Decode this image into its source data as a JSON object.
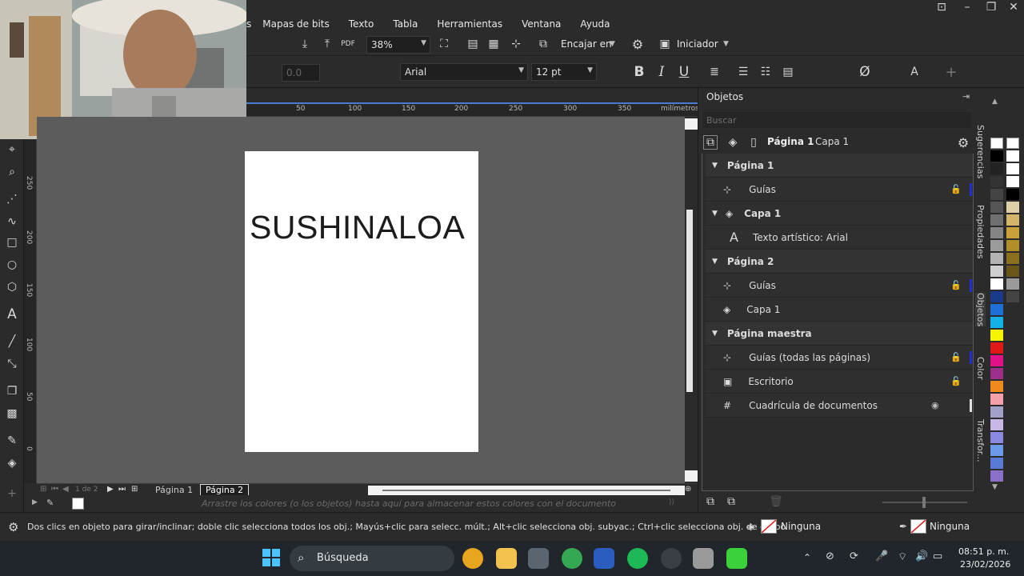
{
  "menu": [
    "s",
    "Mapas de bits",
    "Texto",
    "Tabla",
    "Herramientas",
    "Ventana",
    "Ayuda"
  ],
  "toolbar": {
    "zoom": "38%",
    "snap_label": "Encajar en",
    "launcher_label": "Iniciador",
    "pdf_label": "PDF"
  },
  "propbar": {
    "value_field": "0.0",
    "font_name": "Arial",
    "font_size": "12 pt",
    "bold": "B",
    "italic": "I",
    "underline": "U"
  },
  "ruler": {
    "h_ticks": [
      "50",
      "100",
      "150",
      "200",
      "250",
      "300",
      "350",
      "milímetros"
    ],
    "v_ticks": [
      "250",
      "200",
      "150",
      "100",
      "50",
      "0"
    ]
  },
  "document": {
    "text": "SUSHINALOA"
  },
  "page_nav": {
    "counter": "1 de 2",
    "tabs": [
      "Página 1",
      "Página 2"
    ]
  },
  "palette_hint": "Arrastre los colores (o los objetos) hasta aquí para almacenar estos colores con el documento",
  "objects_panel": {
    "title": "Objetos",
    "search_placeholder": "Buscar",
    "current_page": "Página 1",
    "current_layer": "Capa 1",
    "tree": [
      {
        "label": "Página 1",
        "kind": "page"
      },
      {
        "label": "Guías",
        "kind": "guides"
      },
      {
        "label": "Capa 1",
        "kind": "layer-bold"
      },
      {
        "label": "Texto artístico: Arial",
        "kind": "text"
      },
      {
        "label": "Página 2",
        "kind": "page"
      },
      {
        "label": "Guías",
        "kind": "guides"
      },
      {
        "label": "Capa 1",
        "kind": "layer"
      },
      {
        "label": "Página maestra",
        "kind": "page"
      },
      {
        "label": "Guías (todas las páginas)",
        "kind": "guides"
      },
      {
        "label": "Escritorio",
        "kind": "desktop"
      },
      {
        "label": "Cuadrícula de documentos",
        "kind": "grid"
      }
    ]
  },
  "side_tabs": [
    "Sugerencias",
    "Propiedades",
    "Objetos",
    "Color",
    "Transfor..."
  ],
  "status": {
    "hint": "Dos clics en objeto para girar/inclinar; doble clic selecciona todos los obj.; Mayús+clic para selecc. múlt.; Alt+clic selecciona obj. subyac.; Ctrl+clic selecciona obj. de grupo",
    "fill": "Ninguna",
    "outline": "Ninguna"
  },
  "taskbar": {
    "search": "Búsqueda",
    "time": "08:51 p. m.",
    "date": "23/02/2026"
  },
  "colors": {
    "accent": "#4a7bd0",
    "canvas": "#5c5c5c",
    "panel": "#2b2b2b"
  }
}
